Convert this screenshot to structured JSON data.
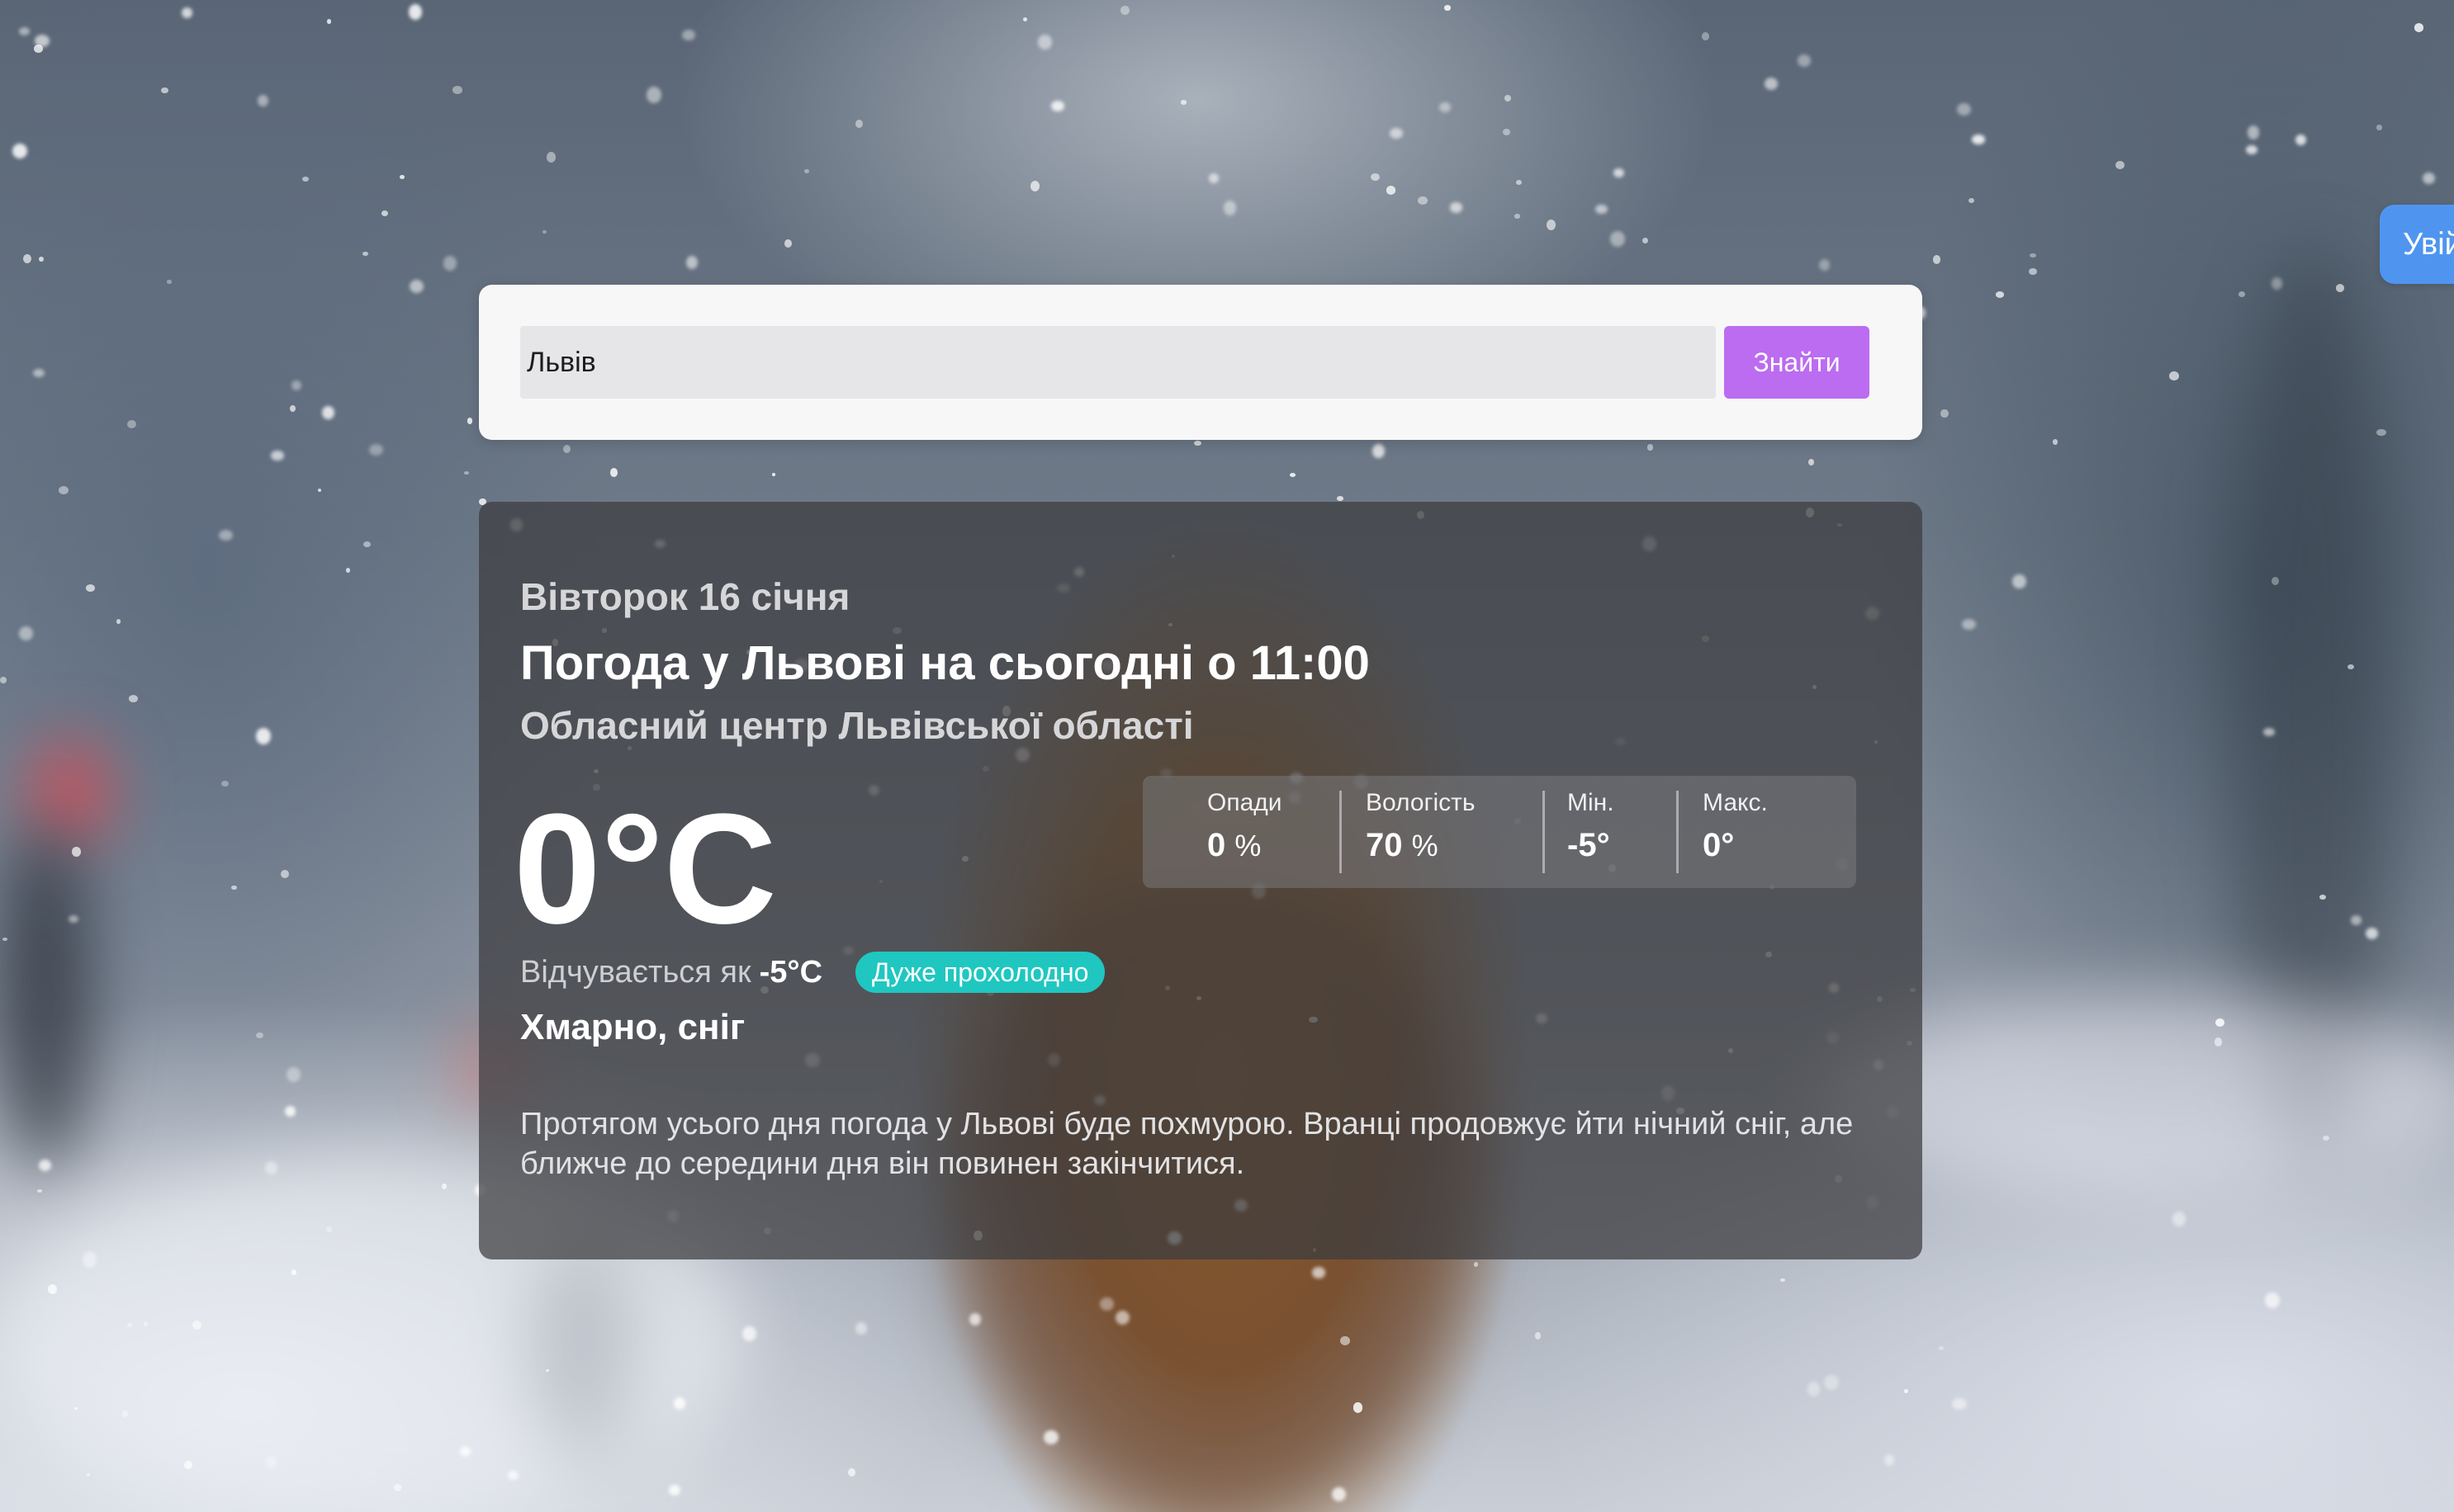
{
  "header": {
    "login_label": "Увійти"
  },
  "search": {
    "value": "Львів",
    "button_label": "Знайти"
  },
  "weather": {
    "date": "Вівторок 16 січня",
    "title": "Погода у Львові на сьогодні о 11:00",
    "subtitle": "Обласний центр Львівської області",
    "temperature": "0°C",
    "feels_like_label": "Відчувається як",
    "feels_like_value": "-5°C",
    "feels_badge": "Дуже прохолодно",
    "condition": "Хмарно, сніг",
    "description": "Протягом усього дня погода у Львові буде похмурою. Вранці продовжує йти нічний сніг, але ближче до середини дня він повинен закінчитися.",
    "stats": [
      {
        "label": "Опади",
        "value": "0",
        "unit": "%"
      },
      {
        "label": "Вологість",
        "value": "70",
        "unit": "%"
      },
      {
        "label": "Мін.",
        "value": "-5°",
        "unit": ""
      },
      {
        "label": "Макс.",
        "value": "0°",
        "unit": ""
      }
    ]
  },
  "colors": {
    "search_button": "#bb6cf0",
    "login_button": "#4f95f0",
    "badge": "#1fc7c0"
  }
}
